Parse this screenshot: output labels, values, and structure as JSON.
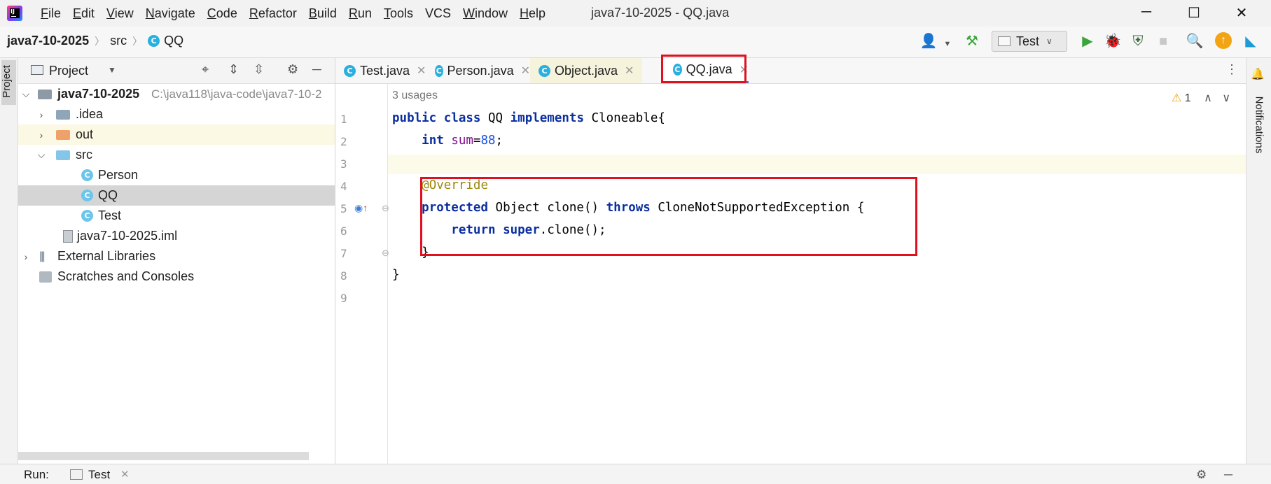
{
  "menubar": {
    "items": [
      {
        "mnemonic": "F",
        "rest": "ile"
      },
      {
        "mnemonic": "E",
        "rest": "dit"
      },
      {
        "mnemonic": "V",
        "rest": "iew"
      },
      {
        "mnemonic": "N",
        "rest": "avigate"
      },
      {
        "mnemonic": "C",
        "rest": "ode"
      },
      {
        "mnemonic": "R",
        "rest": "efactor"
      },
      {
        "mnemonic": "B",
        "rest": "uild"
      },
      {
        "mnemonic": "R",
        "rest": "un"
      },
      {
        "mnemonic": "T",
        "rest": "ools"
      },
      {
        "mnemonic": "",
        "rest": "VCS"
      },
      {
        "mnemonic": "W",
        "rest": "indow"
      },
      {
        "mnemonic": "H",
        "rest": "elp"
      }
    ],
    "window_title": "java7-10-2025 - QQ.java",
    "minimize": "─",
    "maximize": "☐",
    "close": "✕"
  },
  "navbar": {
    "crumb_project": "java7-10-2025",
    "crumb_src": "src",
    "crumb_class": "QQ",
    "run_config": "Test"
  },
  "project_panel": {
    "title": "Project",
    "tree": {
      "root_name": "java7-10-2025",
      "root_path": "C:\\java118\\java-code\\java7-10-2",
      "idea": ".idea",
      "out": "out",
      "src": "src",
      "person": "Person",
      "qq": "QQ",
      "test": "Test",
      "iml": "java7-10-2025.iml",
      "ext_libs": "External Libraries",
      "scratches": "Scratches and Consoles"
    }
  },
  "left_strip": {
    "project_label": "Project"
  },
  "right_strip": {
    "notifications_label": "Notifications"
  },
  "editor": {
    "tabs": {
      "test": "Test.java",
      "person": "Person.java",
      "object": "Object.java",
      "qq": "QQ.java"
    },
    "usages": "3 usages",
    "warning_count": "1",
    "line_numbers": [
      "1",
      "2",
      "3",
      "4",
      "5",
      "6",
      "7",
      "8",
      "9"
    ],
    "code": {
      "l1_kw1": "public",
      "l1_kw2": "class",
      "l1_name": "QQ",
      "l1_kw3": "implements",
      "l1_iface": "Cloneable{",
      "l2_kw": "int",
      "l2_field": "sum",
      "l2_eq": "=",
      "l2_num": "88",
      "l2_end": ";",
      "l4_ann": "@Override",
      "l5_kw1": "protected",
      "l5_mid": "Object clone()",
      "l5_kw2": "throws",
      "l5_end": "CloneNotSupportedException {",
      "l6_kw1": "return",
      "l6_kw2": "super",
      "l6_end": ".clone();",
      "l7": "}",
      "l8": "}"
    }
  },
  "bottombar": {
    "run_label": "Run:",
    "run_tab": "Test"
  },
  "colors": {
    "highlight_box": "#e0101e",
    "keyword": "#0b2fa0",
    "number": "#1750eb",
    "field": "#871094",
    "annotation": "#9e880d",
    "class_icon": "#2ab0e0",
    "run_green": "#3aa63a"
  }
}
